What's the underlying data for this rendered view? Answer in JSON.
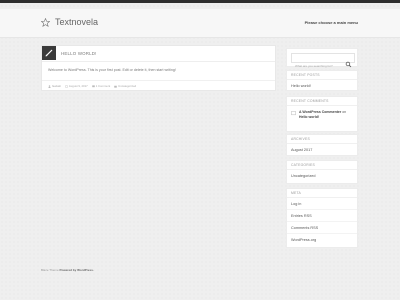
{
  "header": {
    "site_title": "Textnovela",
    "menu_text": "Please choose a main menu"
  },
  "post": {
    "title": "HELLO WORLD!",
    "body": "Welcome to WordPress. This is your first post. Edit or delete it, then start writing!",
    "meta": {
      "author": "faalsalt",
      "date": "August 9, 2017",
      "comments": "1 Comment",
      "category": "Uncategorized"
    }
  },
  "sidebar": {
    "search": {
      "placeholder": "What are you searching for?"
    },
    "recent_posts": {
      "heading": "RECENT POSTS",
      "items": [
        "Hello world!"
      ]
    },
    "recent_comments": {
      "heading": "RECENT COMMENTS",
      "author": "A WordPress Commenter",
      "on_text": "on",
      "post": "Hello world!"
    },
    "archives": {
      "heading": "ARCHIVES",
      "items": [
        "August 2017"
      ]
    },
    "categories": {
      "heading": "CATEGORIES",
      "items": [
        "Uncategorized"
      ]
    },
    "meta": {
      "heading": "META",
      "items": [
        "Log in",
        "Entries RSS",
        "Comments RSS",
        "WordPress.org"
      ]
    }
  },
  "footer": {
    "theme": "Blaze Theme",
    "powered": "Powered by WordPress."
  }
}
